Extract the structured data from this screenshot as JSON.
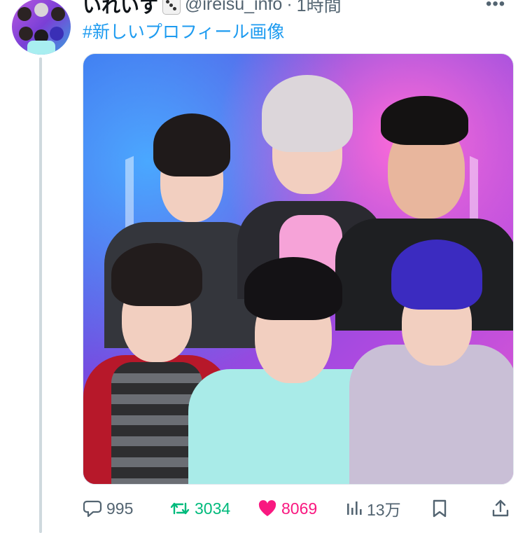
{
  "tweet": {
    "display_name": "いれいす",
    "emoji_icon": "dice-icon",
    "handle": "@ireisu_info",
    "separator": "·",
    "time": "1時間",
    "hashtag": "#新しいプロフィール画像"
  },
  "actions": {
    "replies": "995",
    "retweets": "3034",
    "likes": "8069",
    "views": "13万"
  },
  "colors": {
    "link": "#1d9bf0",
    "retweet": "#00ba7c",
    "like": "#f91880",
    "muted": "#536471"
  }
}
